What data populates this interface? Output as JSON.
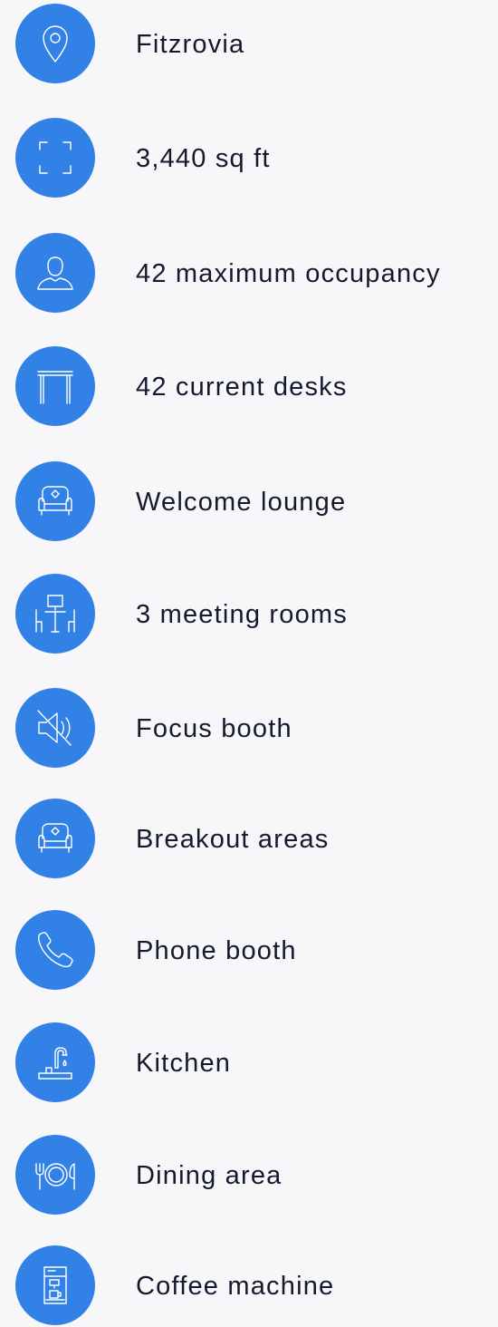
{
  "features": [
    {
      "label": "Fitzrovia",
      "icon": "location-pin-icon"
    },
    {
      "label": "3,440 sq ft",
      "icon": "area-frame-icon"
    },
    {
      "label": "42 maximum occupancy",
      "icon": "person-icon"
    },
    {
      "label": "42 current desks",
      "icon": "desk-icon"
    },
    {
      "label": "Welcome lounge",
      "icon": "armchair-icon"
    },
    {
      "label": "3 meeting rooms",
      "icon": "meeting-table-icon"
    },
    {
      "label": "Focus booth",
      "icon": "muted-speaker-icon"
    },
    {
      "label": "Breakout areas",
      "icon": "armchair-icon"
    },
    {
      "label": "Phone booth",
      "icon": "phone-icon"
    },
    {
      "label": "Kitchen",
      "icon": "tap-icon"
    },
    {
      "label": "Dining area",
      "icon": "dining-plate-icon"
    },
    {
      "label": "Coffee machine",
      "icon": "coffee-machine-icon"
    }
  ],
  "colors": {
    "icon_circle": "#3281e6",
    "text": "#141a2e",
    "background": "#f7f7fa"
  }
}
